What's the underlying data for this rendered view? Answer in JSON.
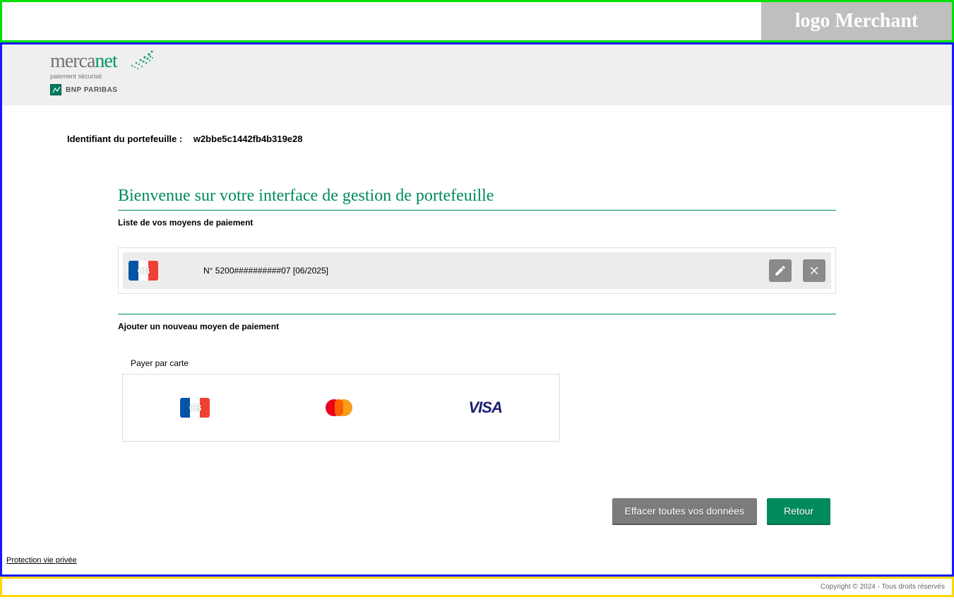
{
  "top": {
    "merchant_logo_text": "logo Merchant"
  },
  "header": {
    "brand_main": "merca",
    "brand_accent": "net",
    "brand_sub": "paiement sécurisé",
    "bank": "BNP PARIBAS"
  },
  "wallet": {
    "label": "Identifiant du portefeuille :",
    "id": "w2bbe5c1442fb4b319e28"
  },
  "page": {
    "title": "Bienvenue sur votre interface de gestion de portefeuille",
    "list_heading": "Liste de vos moyens de paiement",
    "add_heading": "Ajouter un nouveau moyen de paiement",
    "pay_by_card": "Payer par carte"
  },
  "cards": [
    {
      "network": "CB",
      "masked": "N° 5200##########07 [06/2025]"
    }
  ],
  "payment_methods": {
    "cb": "CB",
    "visa": "VISA"
  },
  "actions": {
    "erase": "Effacer toutes vos données",
    "back": "Retour",
    "privacy": "Protection vie privée"
  },
  "footer": {
    "copyright": "Copyright © 2024 - Tous droits réservés"
  }
}
